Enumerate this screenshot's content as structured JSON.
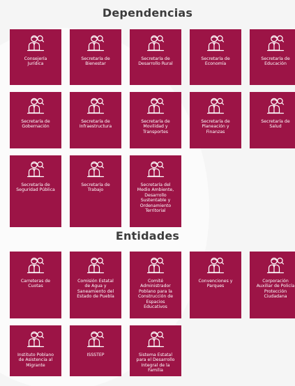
{
  "dependencias": {
    "title": "Dependencias",
    "cards": [
      {
        "label": "Consejería\nJurídica",
        "icon": "official-person-icon"
      },
      {
        "label": "Secretaría de\nBienestar",
        "icon": "official-person-icon"
      },
      {
        "label": "Secretaría de\nDesarrollo Rural",
        "icon": "official-person-icon"
      },
      {
        "label": "Secretaría de\nEconomía",
        "icon": "official-person-icon"
      },
      {
        "label": "Secretaría de\nEducación",
        "icon": "official-person-icon"
      },
      {
        "label": "Secretaría de\nGobernación",
        "icon": "official-person-icon"
      },
      {
        "label": "Secretaría de\nInfraestructura",
        "icon": "official-person-icon"
      },
      {
        "label": "Secretaría de\nMovilidad y\nTransportes",
        "icon": "official-person-icon"
      },
      {
        "label": "Secretaría de\nPlaneación y\nFinanzas",
        "icon": "official-person-icon"
      },
      {
        "label": "Secretaría de\nSalud",
        "icon": "official-person-icon"
      },
      {
        "label": "Secretaría de\nSeguridad Pública",
        "icon": "official-person-icon"
      },
      {
        "label": "Secretaría de\nTrabajo",
        "icon": "official-person-icon"
      },
      {
        "label": "Secretaría del\nMedio Ambiente,\nDesarrollo\nSustentable y\nOrdenamiento\nTerritorial",
        "icon": "official-person-icon"
      }
    ]
  },
  "entidades": {
    "title": "Entidades",
    "cards": [
      {
        "label": "Carreteras de\nCuotas",
        "icon": "official-person-icon"
      },
      {
        "label": "Comisión Estatal\nde Agua y\nSaneamiento del\nEstado de Puebla",
        "icon": "official-person-icon"
      },
      {
        "label": "Comité\nAdministrador\nPoblano para la\nConstrucción de\nEspacios\nEducativos",
        "icon": "official-person-icon"
      },
      {
        "label": "Convenciones y\nParques",
        "icon": "official-person-icon"
      },
      {
        "label": "Corporación\nAuxiliar de Policía\nProtección\nCiudadana",
        "icon": "official-person-icon"
      },
      {
        "label": "Instituto Poblano\nde Asistencia al\nMigrante",
        "icon": "official-person-icon"
      },
      {
        "label": "ISSSTEP",
        "icon": "official-person-icon"
      },
      {
        "label": "Sistema Estatal\npara el Desarrollo\nIntegral de la\nFamilia",
        "icon": "official-person-icon"
      }
    ]
  },
  "colors": {
    "card_background": "#9c1446",
    "card_text": "#ffffff",
    "title_text": "#3c3c3c",
    "page_background": "#f5f5f5"
  }
}
